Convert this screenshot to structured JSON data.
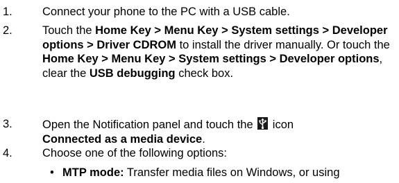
{
  "steps": [
    {
      "number": "1.",
      "text": "Connect your phone to the PC with a USB cable."
    },
    {
      "number": "2.",
      "seg": [
        "Touch the ",
        "Home Key > Menu Key > System settings > Developer options > Driver CDROM",
        " to install the driver manually. Or touch the ",
        "Home Key > Menu Key > System settings > Developer options",
        ", clear the ",
        "USB debugging",
        " check box."
      ]
    },
    {
      "number": "3.",
      "seg": [
        "Open the Notification panel and touch the ",
        " icon ",
        "Connected as a media device",
        "."
      ],
      "icon": "usb-notification-icon"
    },
    {
      "number": "4.",
      "text": "Choose one of the following options:"
    }
  ],
  "bullet": {
    "marker": "•",
    "label": "MTP mode:",
    "text": " Transfer media files on Windows, or using"
  }
}
